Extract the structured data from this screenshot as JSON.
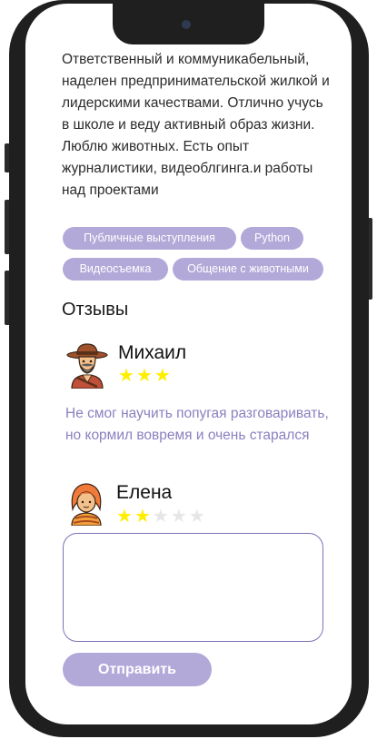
{
  "profile": {
    "about": "Ответственный и коммуникабельный, наделен предпринимательской жилкой и лидерскими качествами. Отлично учусь в школе и веду активный образ жизни. Люблю животных. Есть опыт журналистики, видеоблгинга.и работы над проектами",
    "tags": [
      "Публичные выступления",
      "Python",
      "Видеосъемка",
      "Общение с животными"
    ]
  },
  "reviews": {
    "title": "Отзывы",
    "items": [
      {
        "name": "Михаил",
        "rating": 3,
        "max": 3,
        "avatar_icon": "cowboy-avatar-icon",
        "text": "Не смог научить попугая разговаривать, но кормил вовремя и очень старался"
      },
      {
        "name": "Елена",
        "rating": 2,
        "max": 5,
        "avatar_icon": "woman-avatar-icon"
      }
    ],
    "input_placeholder": "",
    "submit_label": "Отправить"
  },
  "colors": {
    "accent": "#b3a9d9",
    "review_text": "#8a80c0",
    "star_on": "#ffee00",
    "star_off": "#e6e6e6",
    "input_border": "#7a72b8"
  }
}
